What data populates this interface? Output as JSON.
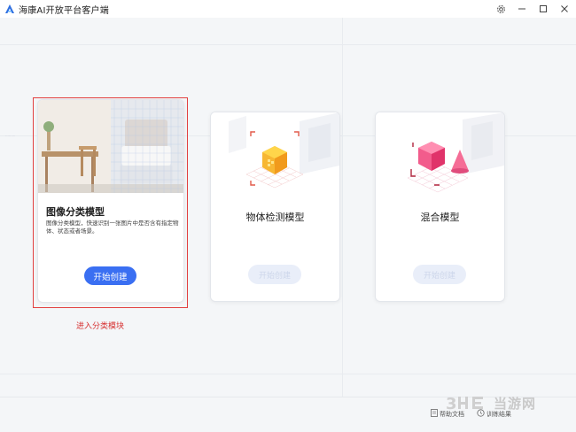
{
  "window": {
    "title": "海康AI开放平台客户端"
  },
  "cards": [
    {
      "title": "图像分类模型",
      "description": "图像分类模型，快速识别一张图片中是否含有指定物体、状态或者场景。",
      "button": "开始创建"
    },
    {
      "title": "物体检测模型",
      "button": "开始创建"
    },
    {
      "title": "混合模型",
      "button": "开始创建"
    }
  ],
  "annotation": "进入分类模块",
  "footer": {
    "help": "帮助文档",
    "results": "训练结果"
  },
  "watermark": {
    "text": "当游网"
  },
  "colors": {
    "accent": "#3a6ff2",
    "highlight": "#e24040",
    "annotation": "#d73333"
  }
}
